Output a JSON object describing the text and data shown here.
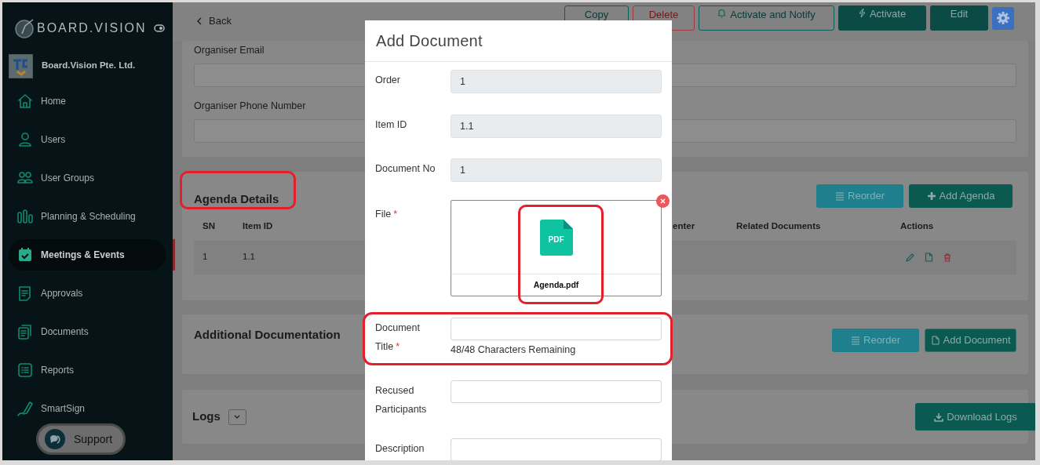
{
  "sidebar": {
    "brand": "BOARD.VISION",
    "organization": "Board.Vision Pte. Ltd.",
    "items": [
      {
        "label": "Home",
        "selected": false
      },
      {
        "label": "Users",
        "selected": false
      },
      {
        "label": "User Groups",
        "selected": false
      },
      {
        "label": "Planning & Scheduling",
        "selected": false
      },
      {
        "label": "Meetings & Events",
        "selected": true
      },
      {
        "label": "Approvals",
        "selected": false
      },
      {
        "label": "Documents",
        "selected": false
      },
      {
        "label": "Reports",
        "selected": false
      },
      {
        "label": "SmartSign",
        "selected": false
      }
    ],
    "support": "Support"
  },
  "header": {
    "back": "Back",
    "actions": [
      {
        "label": "Copy",
        "kind": "outline"
      },
      {
        "label": "Delete",
        "kind": "danger"
      },
      {
        "label": "Activate and Notify",
        "kind": "outline"
      },
      {
        "label": "Activate",
        "kind": "solid"
      },
      {
        "label": "Edit",
        "kind": "solid"
      }
    ]
  },
  "organiser": {
    "fields": [
      {
        "label": "Organiser Email"
      },
      {
        "label": "Organiser Phone Number"
      }
    ]
  },
  "agenda": {
    "title": "Agenda Details",
    "buttons": [
      "Reorder",
      "Add Agenda"
    ],
    "columns": [
      "SN",
      "Item ID",
      "enter",
      "Related Documents",
      "Actions"
    ],
    "rows": [
      {
        "cells": [
          "1",
          "1.1"
        ]
      }
    ]
  },
  "additional": {
    "title": "Additional Documentation",
    "buttons": [
      "Reorder",
      "Add Document"
    ]
  },
  "logs": {
    "title": "Logs",
    "button": "Download Logs"
  },
  "modal": {
    "title": "Add Document",
    "required_mark": "*",
    "fields": [
      {
        "label": "Order",
        "kind": "readonly",
        "value": "1",
        "required": false
      },
      {
        "label": "Item ID",
        "kind": "readonly",
        "value": "1.1",
        "required": false
      },
      {
        "label": "Document No",
        "kind": "readonly",
        "value": "1",
        "required": false
      },
      {
        "label": "File",
        "kind": "file",
        "required": true,
        "file_type": "PDF",
        "file_name": "Agenda.pdf"
      },
      {
        "label": "Document Title",
        "kind": "text",
        "required": true,
        "helper": "48/48 Characters Remaining"
      },
      {
        "label": "Recused Participants",
        "kind": "text",
        "required": false
      },
      {
        "label": "Description",
        "kind": "text",
        "required": false
      }
    ]
  }
}
